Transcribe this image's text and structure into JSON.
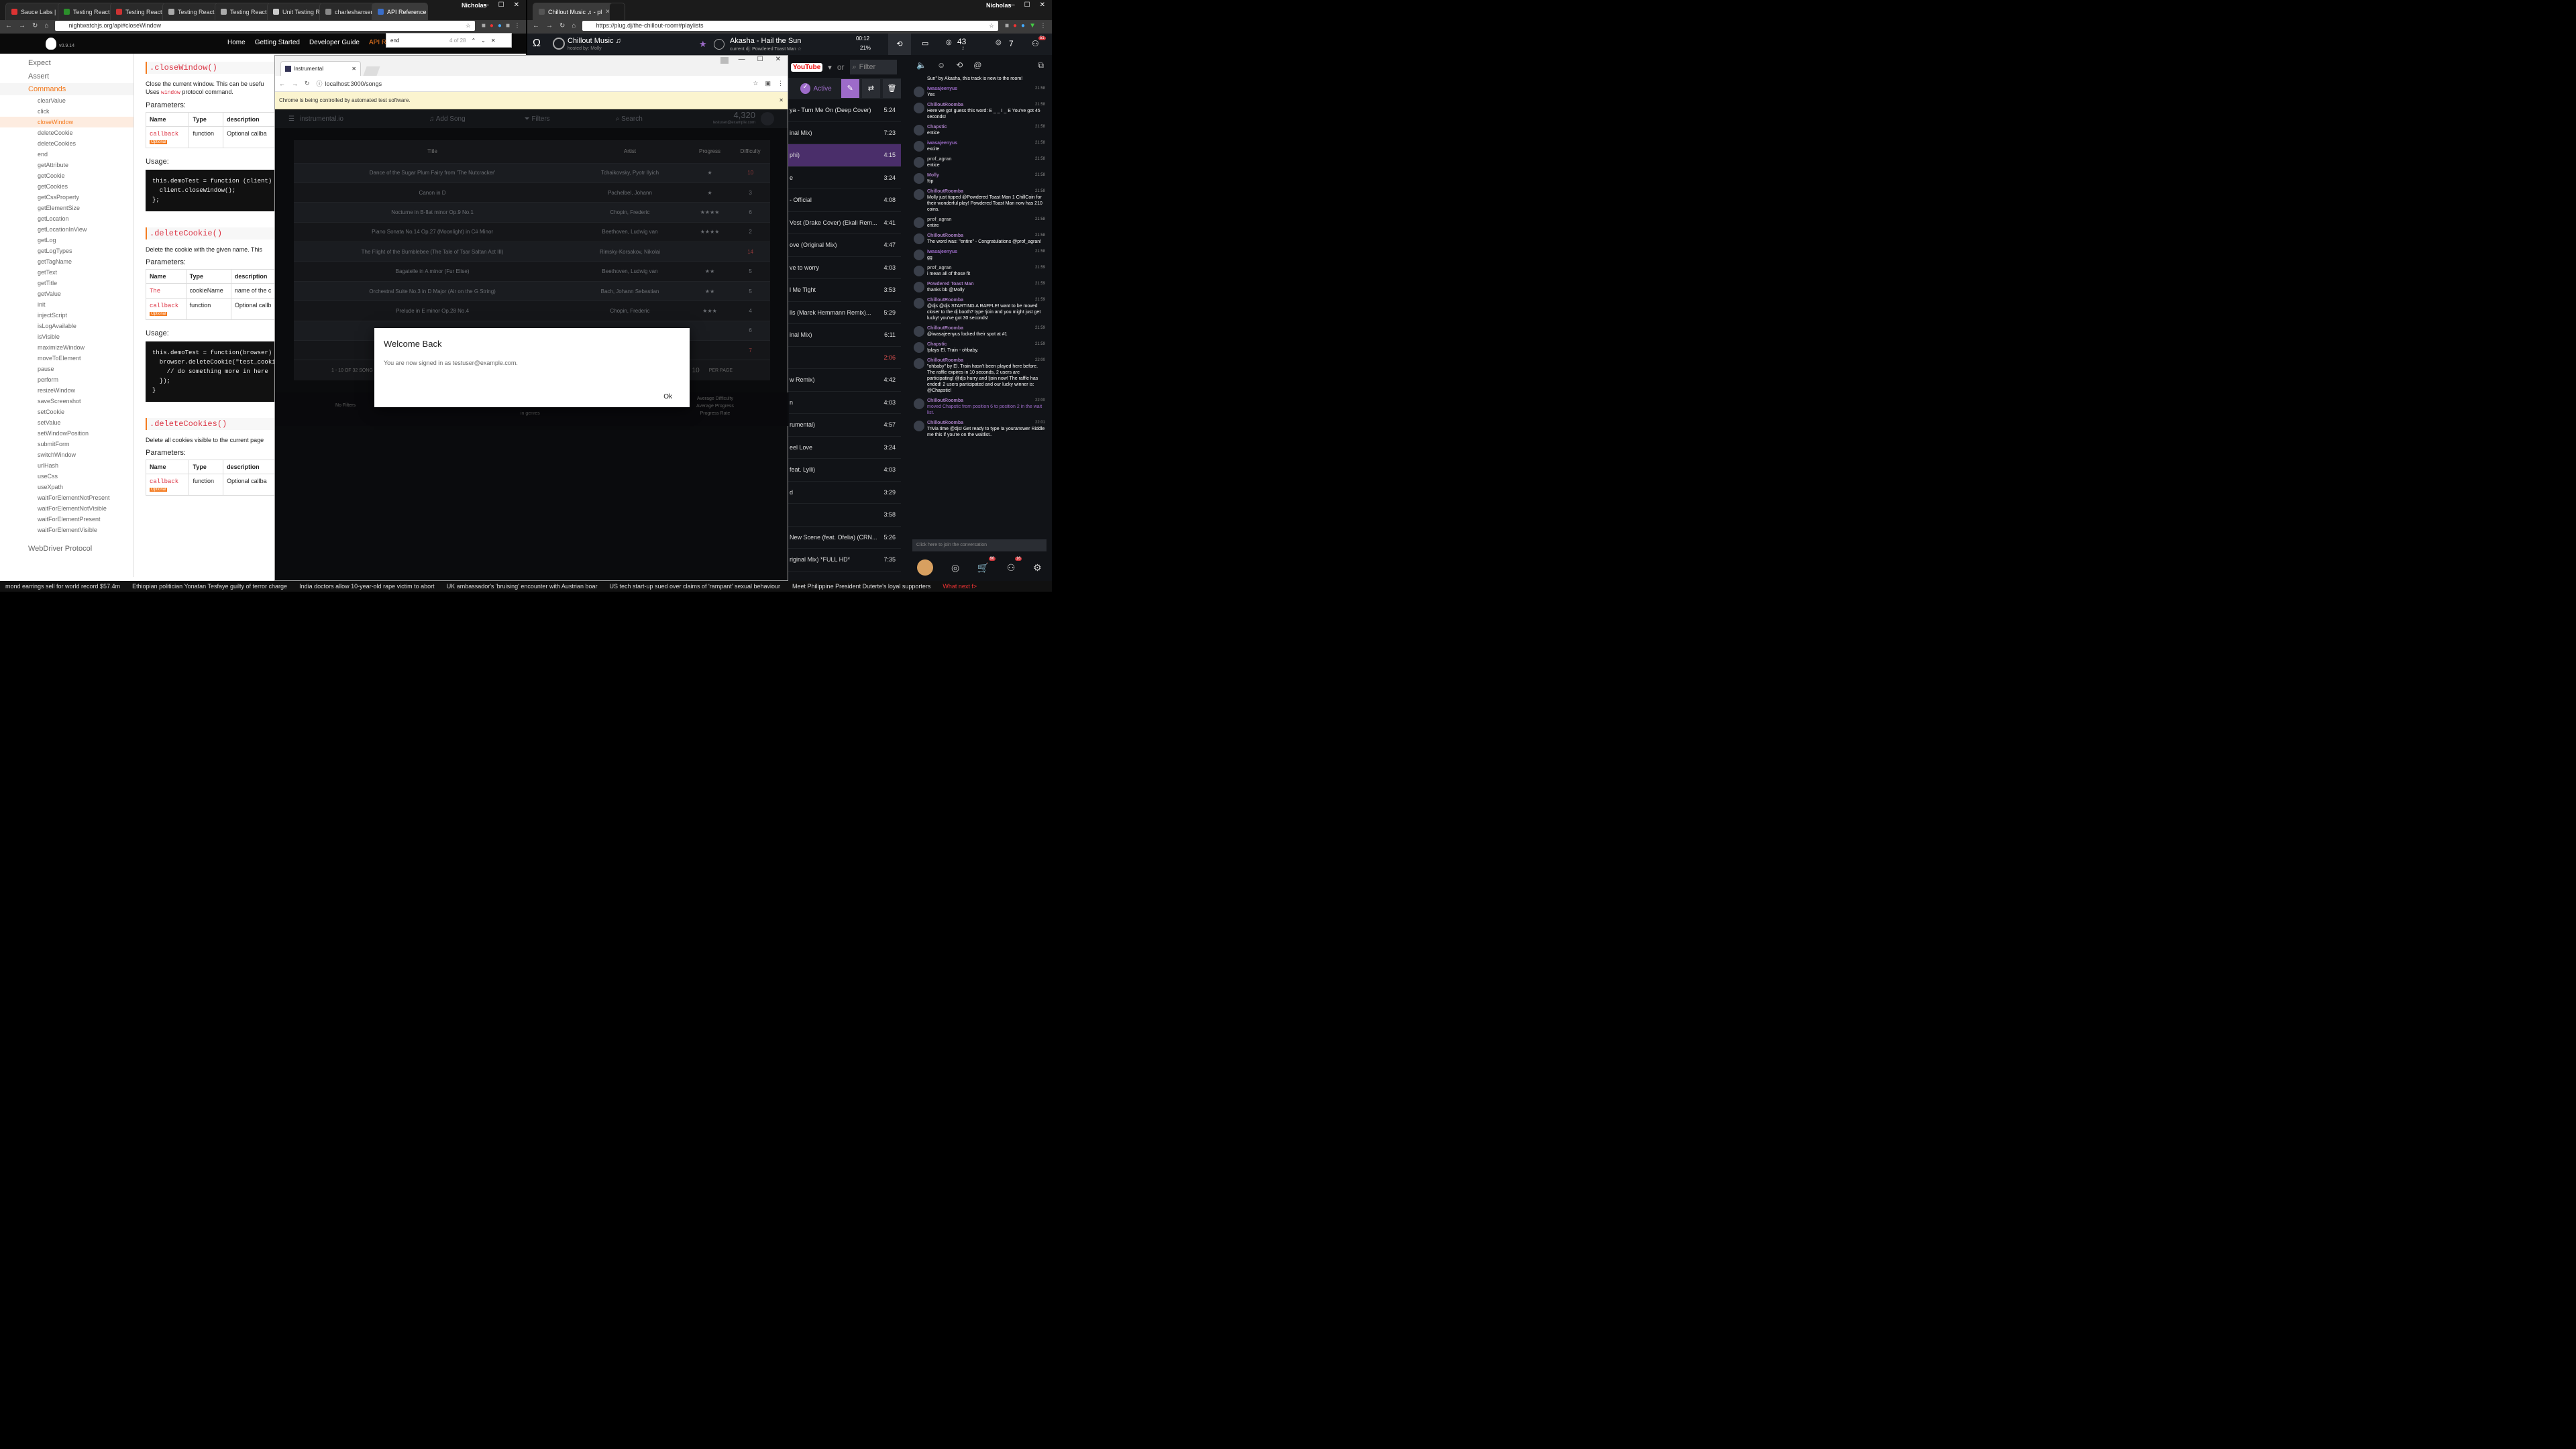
{
  "left_browser": {
    "tabs": [
      "Sauce Labs | D",
      "Testing React",
      "Testing React",
      "Testing React",
      "Testing React",
      "Unit Testing R",
      "charleshansen",
      "API Reference"
    ],
    "user": "Nicholas",
    "url": "nightwatchjs.org/api#closeWindow",
    "find": {
      "query": "end",
      "count": "4 of 28"
    },
    "site": {
      "version": "v0.9.14",
      "nav": [
        "Home",
        "Getting Started",
        "Developer Guide",
        "API Re"
      ],
      "sidebar_top": [
        "Expect",
        "Assert"
      ],
      "sidebar_commands_label": "Commands",
      "commands": [
        "clearValue",
        "click",
        "closeWindow",
        "deleteCookie",
        "deleteCookies",
        "end",
        "getAttribute",
        "getCookie",
        "getCookies",
        "getCssProperty",
        "getElementSize",
        "getLocation",
        "getLocationInView",
        "getLog",
        "getLogTypes",
        "getTagName",
        "getText",
        "getTitle",
        "getValue",
        "init",
        "injectScript",
        "isLogAvailable",
        "isVisible",
        "maximizeWindow",
        "moveToElement",
        "pause",
        "perform",
        "resizeWindow",
        "saveScreenshot",
        "setCookie",
        "setValue",
        "setWindowPosition",
        "submitForm",
        "switchWindow",
        "urlHash",
        "useCss",
        "useXpath",
        "waitForElementNotPresent",
        "waitForElementNotVisible",
        "waitForElementPresent",
        "waitForElementVisible"
      ],
      "sidebar_bottom": "WebDriver Protocol",
      "sections": [
        {
          "title": ".closeWindow()",
          "desc1": "Close the current window. This can be usefu",
          "desc2_pre": "Uses",
          "desc2_code": "window",
          "desc2_post": "protocol command.",
          "params_label": "Parameters:",
          "headers": [
            "Name",
            "Type",
            "description"
          ],
          "rows": [
            {
              "name": "callback",
              "optional": "Optional",
              "type": "function",
              "desc": "Optional callba"
            }
          ],
          "usage_label": "Usage:",
          "code": "this.demoTest = function (client)\n  client.closeWindow();\n};"
        },
        {
          "title": ".deleteCookie()",
          "desc1": "Delete the cookie with the given name. This",
          "params_label": "Parameters:",
          "headers": [
            "Name",
            "Type",
            "description"
          ],
          "rows": [
            {
              "name": "The",
              "optional": "",
              "type": "cookieName",
              "desc": "name of the c"
            },
            {
              "name": "callback",
              "optional": "Optional",
              "type": "function",
              "desc": "Optional callb"
            }
          ],
          "usage_label": "Usage:",
          "code": "this.demoTest = function(browser)\n  browser.deleteCookie(\"test_cooki\n    // do something more in here\n  });\n}"
        },
        {
          "title": ".deleteCookies()",
          "desc1": "Delete all cookies visible to the current page",
          "params_label": "Parameters:",
          "headers": [
            "Name",
            "Type",
            "description"
          ],
          "rows": [
            {
              "name": "callback",
              "optional": "Optional",
              "type": "function",
              "desc": "Optional callba"
            }
          ]
        }
      ]
    }
  },
  "right_browser": {
    "tab": "Chillout Music ♫ - pl",
    "user": "Nicholas",
    "url": "https://plug.dj/the-chillout-room#playlists",
    "room_name": "Chillout Music ♫",
    "hosted_by": "hosted by: Molly",
    "now_playing": "Akasha - Hail the Sun",
    "current_dj": "current dj: Powdered Toast Man ☆",
    "time_left": "00:12",
    "volume": "21%",
    "listeners": "43",
    "listeners_sub": "2",
    "waitlist": "7",
    "notifications": "51",
    "source": "YouTube",
    "filter_placeholder": "Filter",
    "active_label": "Active",
    "playlist": [
      {
        "title": "ya - Turn Me On (Deep Cover)",
        "dur": "5:24"
      },
      {
        "title": "inal Mix)",
        "dur": "7:23"
      },
      {
        "title": "phi)",
        "dur": "4:15"
      },
      {
        "title": "e",
        "dur": "3:24"
      },
      {
        "title": "- Official",
        "dur": "4:08"
      },
      {
        "title": "Vest (Drake Cover) (Ekali Rem...",
        "dur": "4:41"
      },
      {
        "title": "ove (Original Mix)",
        "dur": "4:47"
      },
      {
        "title": "ve to worry",
        "dur": "4:03"
      },
      {
        "title": "l Me Tight",
        "dur": "3:53"
      },
      {
        "title": "lls (Marek Hemmann Remix)...",
        "dur": "5:29"
      },
      {
        "title": "inal Mix)",
        "dur": "6:11"
      },
      {
        "title": "",
        "dur": "2:06"
      },
      {
        "title": "w Remix)",
        "dur": "4:42"
      },
      {
        "title": "n",
        "dur": "4:03"
      },
      {
        "title": "rumental)",
        "dur": "4:57"
      },
      {
        "title": "eel Love",
        "dur": "3:24"
      },
      {
        "title": "feat. Lylli)",
        "dur": "4:03"
      },
      {
        "title": "d",
        "dur": "3:29"
      },
      {
        "title": "",
        "dur": "3:58"
      },
      {
        "title": "New Scene (feat. Ofelia) (CRN...",
        "dur": "5:26"
      },
      {
        "title": "riginal Mix) *FULL HD*",
        "dur": "7:35"
      }
    ],
    "chat": [
      {
        "name": "",
        "time": "",
        "text": "Sun\" by Akasha, this track is new to the room!"
      },
      {
        "name": "iwasajeenyus",
        "time": "21:58",
        "text": "Yes"
      },
      {
        "name": "ChilloutRoomba",
        "time": "21:58",
        "text": "Here we go! guess this word: E _ _ I _ E  You've got 45 seconds!"
      },
      {
        "name": "Chapstic",
        "time": "21:58",
        "text": "entice"
      },
      {
        "name": "iwasajeenyus",
        "time": "21:58",
        "text": "excite"
      },
      {
        "name": "prof_agran",
        "time": "21:58",
        "text": "entice"
      },
      {
        "name": "Molly",
        "time": "21:58",
        "text": "!tip"
      },
      {
        "name": "ChilloutRoomba",
        "time": "21:58",
        "text": "Molly just tipped @Powdered Toast Man 1 ChillCoin for their wonderful play! Powdered Toast Man now has 210 coins."
      },
      {
        "name": "prof_agran",
        "time": "21:58",
        "text": "entire"
      },
      {
        "name": "ChilloutRoomba",
        "time": "21:58",
        "text": "The word was: \"entire\" - Congratulations @prof_agran!"
      },
      {
        "name": "iwasajeenyus",
        "time": "21:58",
        "text": "gg"
      },
      {
        "name": "prof_agran",
        "time": "21:59",
        "text": "i mean all of those fit"
      },
      {
        "name": "Powdered Toast Man",
        "time": "21:59",
        "text": "thanks bb @Molly"
      },
      {
        "name": "ChilloutRoomba",
        "time": "21:59",
        "text": "@djs @djs STARTING A RAFFLE! want to be moved closer to the dj booth? type !join and you might just get lucky! you've got 30 seconds!"
      },
      {
        "name": "ChilloutRoomba",
        "time": "21:59",
        "text": "@iwasajeenyus locked their spot at #1"
      },
      {
        "name": "Chapstic",
        "time": "21:59",
        "text": "!plays El. Train - ohbaby."
      },
      {
        "name": "ChilloutRoomba",
        "time": "22:00",
        "text": "\"ohbaby\" by El. Train hasn't been played here before. The raffle expires in 10 seconds, 2 users are participating! @djs hurry and !join now! The raffle has ended! 2 users participated and our lucky winner is: @Chapstic!"
      },
      {
        "name": "ChilloutRoomba",
        "time": "22:00",
        "text": "moved Chapstic from position 6 to position 2 in the wait list."
      },
      {
        "name": "ChilloutRoomba",
        "time": "22:01",
        "text": "Trivia time @djs! Get ready to type !a youranswer Riddle me this if you're on the waitlist.."
      }
    ],
    "chat_input_placeholder": "Click here to join the conversation",
    "badges": {
      "shop": "90",
      "friends": "16"
    }
  },
  "app_window": {
    "tab": "Instrumental",
    "url": "localhost:3000/songs",
    "automation_notice": "Chrome is being controlled by automated test software.",
    "brand": "instrumental.io",
    "add_song": "Add Song",
    "filters": "Filters",
    "search": "Search",
    "score": "4,320",
    "email": "testuser@example.com",
    "headers": [
      "Title",
      "Artist",
      "Progress",
      "Difficulty"
    ],
    "songs": [
      {
        "title": "Dance of the Sugar Plum Fairy from 'The Nutcracker'",
        "artist": "Tchaikovsky, Pyotr Ilyich",
        "progress": 1,
        "difficulty": "10",
        "hard": true
      },
      {
        "title": "Canon in D",
        "artist": "Pachelbel, Johann",
        "progress": 1,
        "difficulty": "3",
        "hard": false
      },
      {
        "title": "Nocturne in B-flat minor Op.9 No.1",
        "artist": "Chopin, Frederic",
        "progress": 4,
        "difficulty": "6",
        "hard": false
      },
      {
        "title": "Piano Sonata No.14 Op.27 (Moonlight) in C# Minor",
        "artist": "Beethoven, Ludwig van",
        "progress": 4,
        "difficulty": "2",
        "hard": false
      },
      {
        "title": "The Flight of the Bumblebee (The Tale of Tsar Saltan Act III)",
        "artist": "Rimsky-Korsakov, Nikolai",
        "progress": 0,
        "difficulty": "14",
        "hard": true
      },
      {
        "title": "Bagatelle in A minor (Fur Elise)",
        "artist": "Beethoven, Ludwig van",
        "progress": 2,
        "difficulty": "5",
        "hard": false
      },
      {
        "title": "Orchestral Suite No.3 in D Major (Air on the G String)",
        "artist": "Bach, Johann Sebastian",
        "progress": 2,
        "difficulty": "5",
        "hard": false
      },
      {
        "title": "Prelude in E minor Op.28 No.4",
        "artist": "Chopin, Frederic",
        "progress": 3,
        "difficulty": "4",
        "hard": false
      },
      {
        "title": "Noc",
        "artist": "",
        "progress": 0,
        "difficulty": "6",
        "hard": false
      },
      {
        "title": "Pia",
        "artist": "",
        "progress": 0,
        "difficulty": "7",
        "hard": true
      }
    ],
    "pagination": "1 - 10 OF 32 SONG",
    "per_page_value": "10",
    "per_page": "PER PAGE",
    "footer": {
      "no_filters": "No Filters",
      "in_genres": "in genres",
      "stats": [
        "Average Difficulty",
        "Average Progress",
        "Progress Rate"
      ]
    },
    "modal": {
      "title": "Welcome Back",
      "body": "You are now signed in as testuser@example.com.",
      "ok": "Ok"
    }
  },
  "ticker": [
    "mond earrings sell for world record $57.4m",
    "Ethiopian politician Yonatan Tesfaye guilty of terror charge",
    "India doctors allow 10-year-old rape victim to abort",
    "UK ambassador's 'bruising' encounter with Austrian boar",
    "US tech start-up sued over claims of 'rampant' sexual behaviour",
    "Meet Philippine President Duterte's loyal supporters",
    "What next f>"
  ],
  "colors": {
    "accent_nightwatch": "#f47b20",
    "plug_purple": "#9d6bc9",
    "hard_red": "#e06060",
    "star": "#c8a800"
  }
}
